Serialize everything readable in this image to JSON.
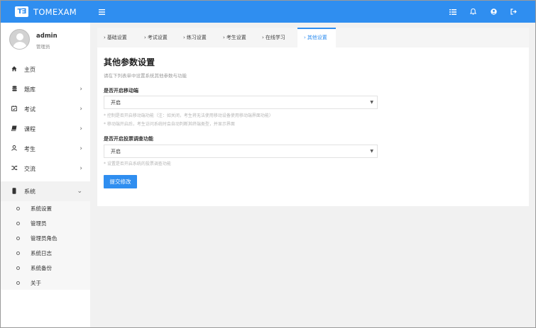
{
  "brand": {
    "logo": "T∃",
    "name": "TOMEXAM"
  },
  "topbar": {
    "icons": [
      "menu-toggle-icon",
      "list-icon",
      "bell-icon",
      "user-circle-icon",
      "logout-icon"
    ]
  },
  "user": {
    "name": "admin",
    "role": "管理员"
  },
  "sidebar": {
    "items": [
      {
        "label": "主页",
        "icon": "home-icon"
      },
      {
        "label": "题库",
        "icon": "database-icon"
      },
      {
        "label": "考试",
        "icon": "calendar-check-icon"
      },
      {
        "label": "课程",
        "icon": "book-icon"
      },
      {
        "label": "考生",
        "icon": "user-icon"
      },
      {
        "label": "交流",
        "icon": "shuffle-icon"
      },
      {
        "label": "系统",
        "icon": "mobile-icon"
      }
    ],
    "submenu": [
      {
        "label": "系统设置"
      },
      {
        "label": "管理员"
      },
      {
        "label": "管理员角色"
      },
      {
        "label": "系统日志"
      },
      {
        "label": "系统备份"
      },
      {
        "label": "关于"
      }
    ]
  },
  "tabs": [
    {
      "label": "基础设置"
    },
    {
      "label": "考试设置"
    },
    {
      "label": "练习设置"
    },
    {
      "label": "考生设置"
    },
    {
      "label": "在线学习"
    },
    {
      "label": "其他设置"
    }
  ],
  "main": {
    "title": "其他参数设置",
    "description": "请在下列表单中设置系统其他参数与功能",
    "mobile": {
      "label": "是否开启移动端",
      "value": "开启",
      "hint1": "* 控制是否开启移动端功能（注：如关闭，考生将无法使用移动设备使用移动端界面功能）",
      "hint2": "* 移动端开启后，考生访问系统时会自动判断其终端类型，并显示界面"
    },
    "survey": {
      "label": "是否开启投票调查功能",
      "value": "开启",
      "hint1": "* 设置是否开启系统的投票调查功能"
    },
    "submit": "提交修改"
  }
}
